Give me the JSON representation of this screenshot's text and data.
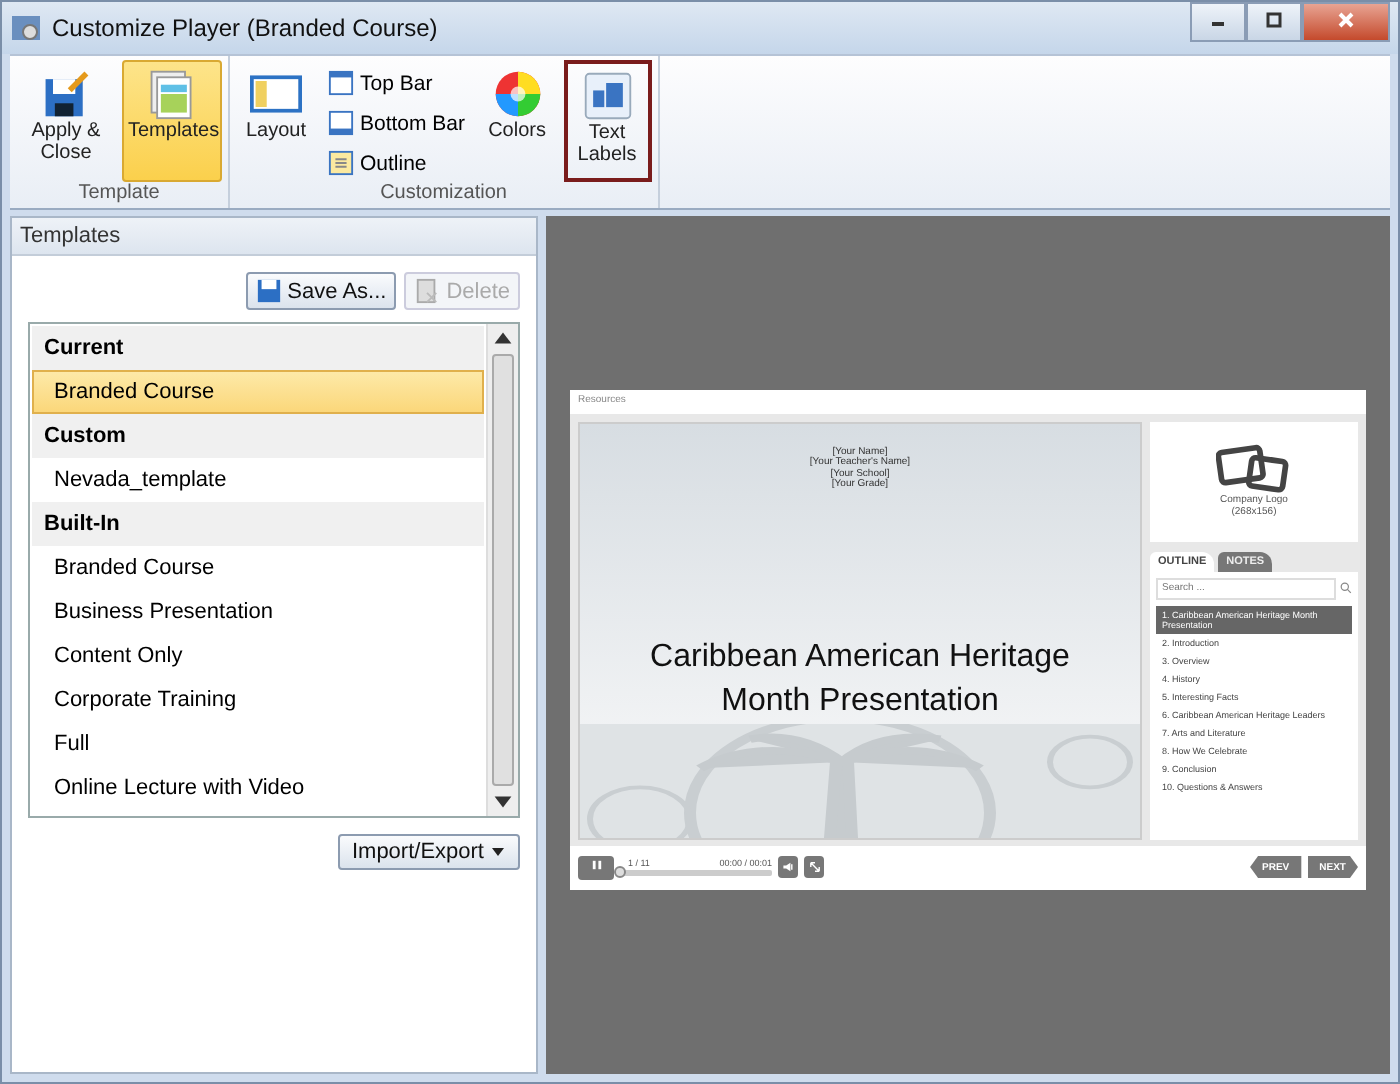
{
  "window": {
    "title": "Customize Player (Branded Course)"
  },
  "ribbon": {
    "groups": [
      {
        "label": "Template",
        "buttons": [
          {
            "kind": "large",
            "label": "Apply & Close",
            "selected": false,
            "outlined": false
          },
          {
            "kind": "large",
            "label": "Templates",
            "selected": true,
            "outlined": false
          }
        ]
      },
      {
        "label": "Customization",
        "buttons": [
          {
            "kind": "large",
            "label": "Layout",
            "selected": false,
            "outlined": false
          },
          {
            "kind": "small",
            "label": "Top Bar",
            "selected": false,
            "outlined": false
          },
          {
            "kind": "small",
            "label": "Bottom Bar",
            "selected": false,
            "outlined": false
          },
          {
            "kind": "small",
            "label": "Outline",
            "selected": false,
            "outlined": false
          },
          {
            "kind": "large",
            "label": "Colors",
            "selected": false,
            "outlined": false
          },
          {
            "kind": "large",
            "label": "Text Labels",
            "selected": false,
            "outlined": true
          }
        ]
      }
    ]
  },
  "templates": {
    "title": "Templates",
    "save_as": "Save As...",
    "delete": {
      "label": "Delete",
      "disabled": true
    },
    "sections": [
      {
        "heading": "Current",
        "items": [
          {
            "label": "Branded Course",
            "selected": true
          }
        ]
      },
      {
        "heading": "Custom",
        "items": [
          {
            "label": "Nevada_template",
            "selected": false
          }
        ]
      },
      {
        "heading": "Built-In",
        "items": [
          {
            "label": "Branded Course",
            "selected": false
          },
          {
            "label": "Business Presentation",
            "selected": false
          },
          {
            "label": "Content Only",
            "selected": false
          },
          {
            "label": "Corporate Training",
            "selected": false
          },
          {
            "label": "Full",
            "selected": false
          },
          {
            "label": "Online Lecture with Video",
            "selected": false
          }
        ]
      }
    ],
    "import_export": "Import/Export"
  },
  "preview": {
    "top_label": "Resources",
    "slide": {
      "details": [
        "[Your Name]",
        "[Your Teacher's Name]",
        "[Your School]",
        "[Your Grade]"
      ],
      "title": "Caribbean American Heritage Month Presentation"
    },
    "logo": {
      "name": "Company Logo",
      "size": "(268x156)"
    },
    "tabs": [
      {
        "label": "OUTLINE",
        "selected": true
      },
      {
        "label": "NOTES",
        "selected": false
      }
    ],
    "search": {
      "placeholder": "Search ..."
    },
    "outline": [
      {
        "label": "1. Caribbean American Heritage Month Presentation",
        "selected": true
      },
      {
        "label": "2. Introduction",
        "selected": false
      },
      {
        "label": "3. Overview",
        "selected": false
      },
      {
        "label": "4. History",
        "selected": false
      },
      {
        "label": "5. Interesting Facts",
        "selected": false
      },
      {
        "label": "6. Caribbean American Heritage Leaders",
        "selected": false
      },
      {
        "label": "7. Arts and Literature",
        "selected": false
      },
      {
        "label": "8. How We Celebrate",
        "selected": false
      },
      {
        "label": "9. Conclusion",
        "selected": false
      },
      {
        "label": "10. Questions & Answers",
        "selected": false
      }
    ],
    "controls": {
      "slide_count": "1 / 11",
      "time": "00:00 / 00:01",
      "seek": {
        "level": 0
      },
      "prev": "PREV",
      "next": "NEXT"
    }
  }
}
